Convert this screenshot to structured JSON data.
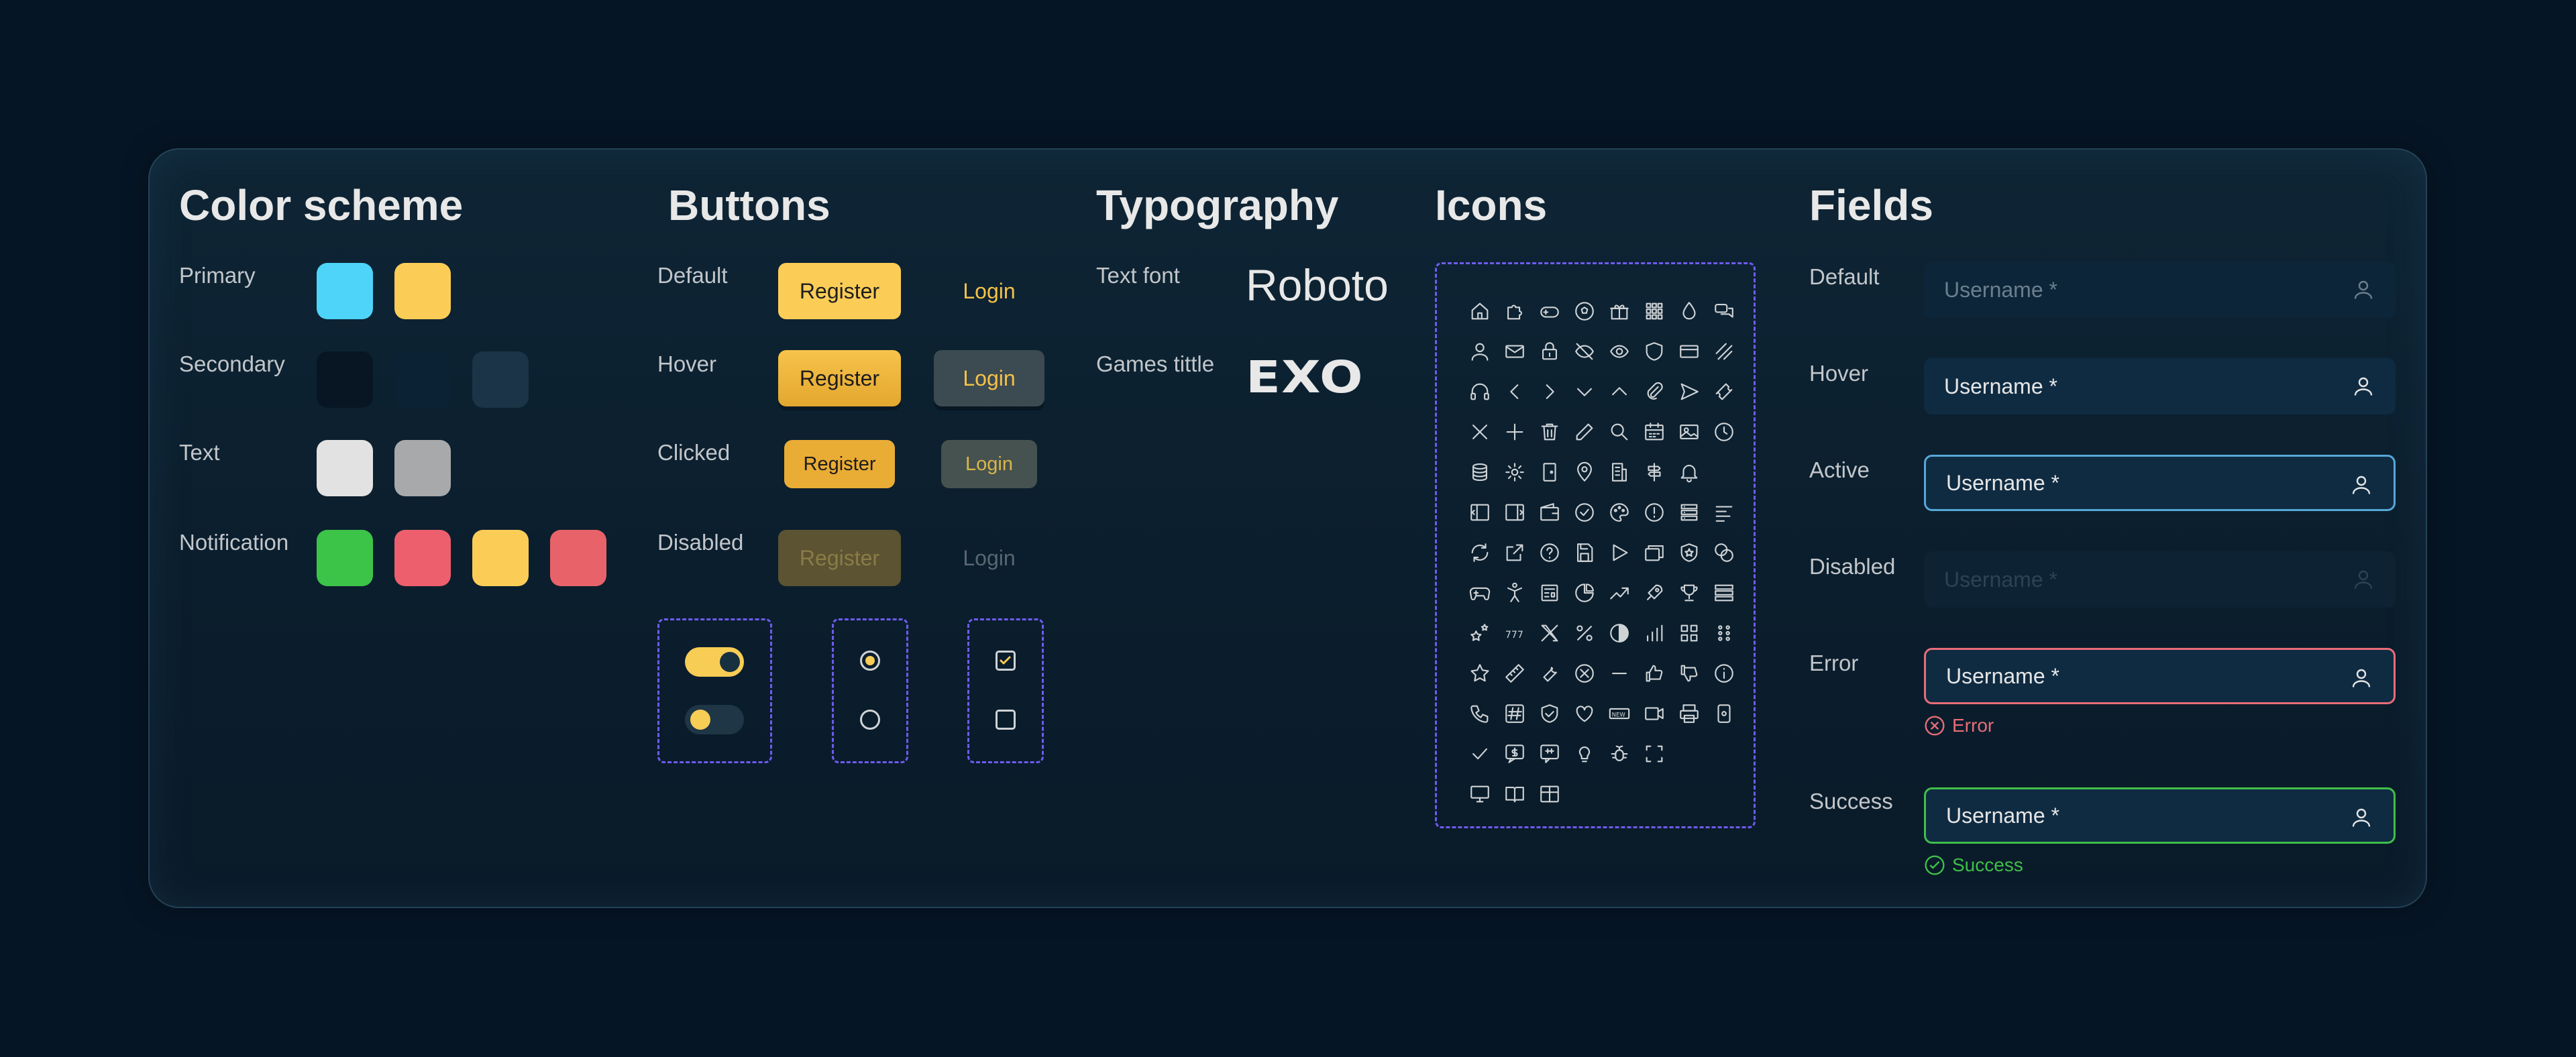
{
  "sections": {
    "color_scheme": "Color scheme",
    "buttons": "Buttons",
    "typography": "Typography",
    "icons": "Icons",
    "fields": "Fields"
  },
  "colors": {
    "primary_label": "Primary",
    "primary": [
      "#4dd4f8",
      "#fbcd57"
    ],
    "secondary_label": "Secondary",
    "secondary": [
      "#081624",
      "#0b2234",
      "#1b3447"
    ],
    "text_label": "Text",
    "text": [
      "#e2e2e2",
      "#a8a9aa"
    ],
    "notification_label": "Notification",
    "notification": [
      "#3cc449",
      "#ed5f6d",
      "#fbcd57",
      "#e76369"
    ]
  },
  "buttons": {
    "default_label": "Default",
    "hover_label": "Hover",
    "clicked_label": "Clicked",
    "disabled_label": "Disabled",
    "register": "Register",
    "login": "Login"
  },
  "typography": {
    "text_font_label": "Text font",
    "text_font_sample": "Roboto",
    "games_title_label": "Games tittle",
    "games_title_sample": "EXO"
  },
  "icons": [
    "home",
    "puzzle",
    "gamepad",
    "soccer-ball",
    "gift",
    "grid-dots",
    "drop",
    "chat",
    "user",
    "mail",
    "lock",
    "eye-off",
    "eye",
    "shield",
    "card",
    "slash-lines",
    "headset",
    "chevron-left",
    "chevron-right",
    "chevron-down",
    "chevron-up",
    "paperclip",
    "send",
    "ticket",
    "close",
    "plus",
    "trash",
    "edit",
    "search",
    "calendar",
    "image",
    "clock",
    "coins",
    "gear",
    "door",
    "map-pin",
    "building",
    "signpost",
    "bell",
    "blank",
    "sidebar-left",
    "sidebar-right",
    "wallet",
    "check-circle",
    "palette",
    "alert-circle",
    "list",
    "align-left",
    "refresh",
    "external",
    "help-circle",
    "save",
    "play",
    "cards",
    "shield-star",
    "chips",
    "game-controller",
    "acrobat",
    "newspaper",
    "pie-chart",
    "trend-up",
    "rocket",
    "trophy",
    "rows",
    "stars",
    "777",
    "x-logo",
    "percent",
    "contrast",
    "bar-chart",
    "apps",
    "dots-grid",
    "star",
    "ruler",
    "wrench",
    "x-circle",
    "minus",
    "thumb-up",
    "thumb-down",
    "info",
    "phone",
    "hashtag",
    "shield-check",
    "heart",
    "new-badge",
    "video",
    "printer",
    "device",
    "check",
    "dollar-chat",
    "phone-chat",
    "lightbulb",
    "bug",
    "scan",
    "blank",
    "blank",
    "monitor",
    "book",
    "table"
  ],
  "fields": {
    "default_label": "Default",
    "hover_label": "Hover",
    "active_label": "Active",
    "disabled_label": "Disabled",
    "error_label": "Error",
    "success_label": "Success",
    "placeholder": "Username *",
    "error_message": "Error",
    "success_message": "Success"
  }
}
